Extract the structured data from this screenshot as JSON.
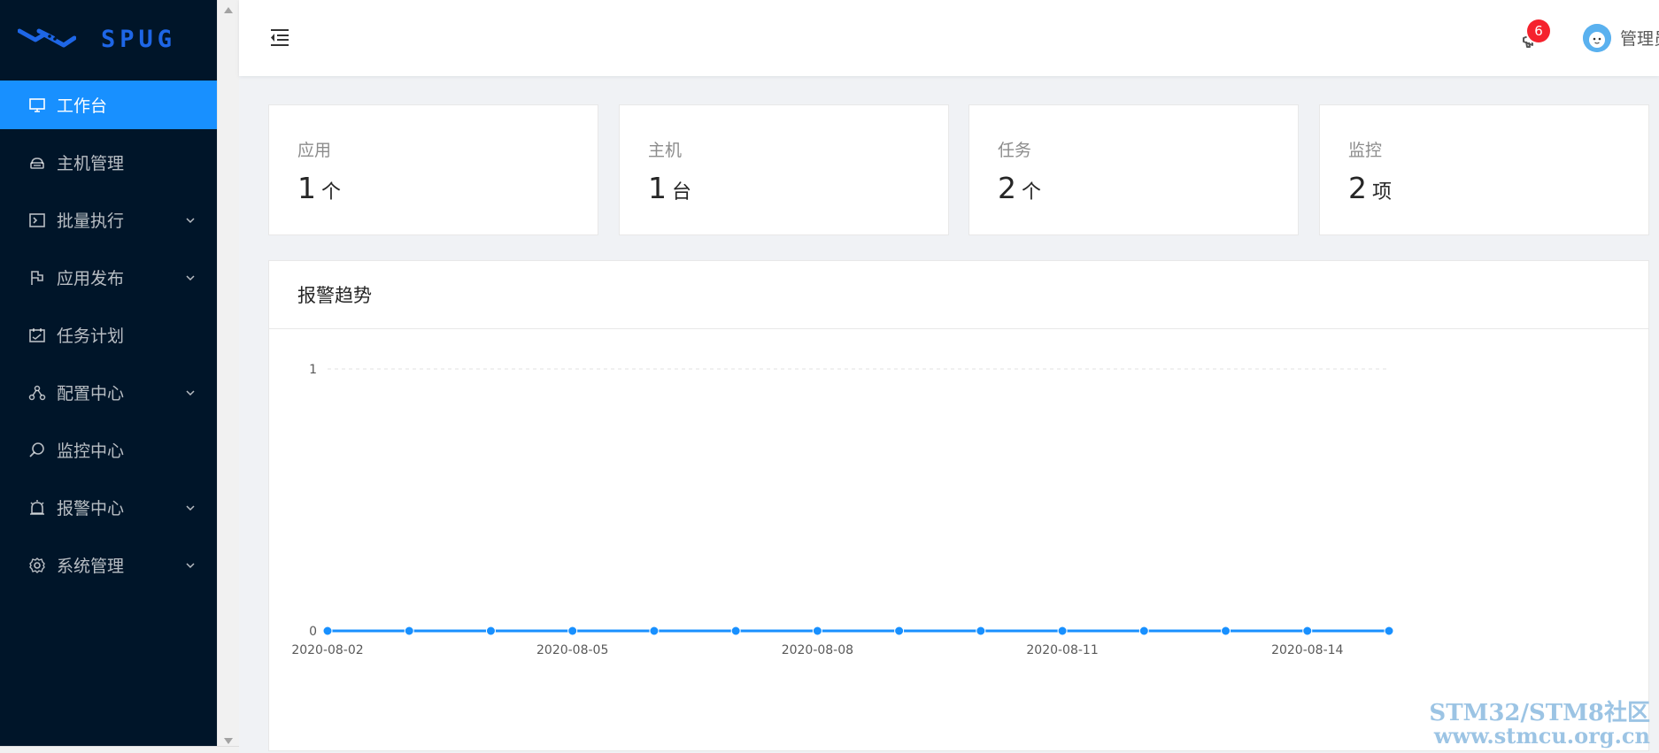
{
  "app": {
    "logo_text": "SPUG",
    "colors": {
      "sidebar_bg": "#001529",
      "accent": "#1890ff",
      "badge": "#f5222d",
      "series": "#1890ff"
    }
  },
  "sidebar": {
    "items": [
      {
        "label": "工作台",
        "icon": "desktop-icon",
        "active": true,
        "expandable": false
      },
      {
        "label": "主机管理",
        "icon": "cloud-server-icon",
        "active": false,
        "expandable": false
      },
      {
        "label": "批量执行",
        "icon": "code-terminal-icon",
        "active": false,
        "expandable": true
      },
      {
        "label": "应用发布",
        "icon": "flag-icon",
        "active": false,
        "expandable": true
      },
      {
        "label": "任务计划",
        "icon": "schedule-icon",
        "active": false,
        "expandable": false
      },
      {
        "label": "配置中心",
        "icon": "deployment-unit-icon",
        "active": false,
        "expandable": true
      },
      {
        "label": "监控中心",
        "icon": "monitor-search-icon",
        "active": false,
        "expandable": false
      },
      {
        "label": "报警中心",
        "icon": "alert-icon",
        "active": false,
        "expandable": true
      },
      {
        "label": "系统管理",
        "icon": "setting-icon",
        "active": false,
        "expandable": true
      }
    ]
  },
  "header": {
    "notification_count": "6",
    "username": "管理员"
  },
  "stats": [
    {
      "label": "应用",
      "value": "1",
      "unit": "个"
    },
    {
      "label": "主机",
      "value": "1",
      "unit": "台"
    },
    {
      "label": "任务",
      "value": "2",
      "unit": "个"
    },
    {
      "label": "监控",
      "value": "2",
      "unit": "项"
    }
  ],
  "panel": {
    "title": "报警趋势"
  },
  "chart_data": {
    "type": "line",
    "title": "报警趋势",
    "xlabel": "",
    "ylabel": "",
    "x": [
      "2020-08-02",
      "2020-08-03",
      "2020-08-04",
      "2020-08-05",
      "2020-08-06",
      "2020-08-07",
      "2020-08-08",
      "2020-08-09",
      "2020-08-10",
      "2020-08-11",
      "2020-08-12",
      "2020-08-13",
      "2020-08-14",
      "2020-08-15"
    ],
    "x_tick_labels": [
      "2020-08-02",
      "2020-08-05",
      "2020-08-08",
      "2020-08-11",
      "2020-08-14"
    ],
    "y_ticks": [
      "0",
      "1"
    ],
    "ylim": [
      0,
      1
    ],
    "series": [
      {
        "values": [
          0,
          0,
          0,
          0,
          0,
          0,
          0,
          0,
          0,
          0,
          0,
          0,
          0,
          0
        ]
      }
    ],
    "grid": true,
    "legend": "none"
  },
  "watermark": {
    "line1": "STM32/STM8社区",
    "line2": "www.stmcu.org.cn"
  }
}
